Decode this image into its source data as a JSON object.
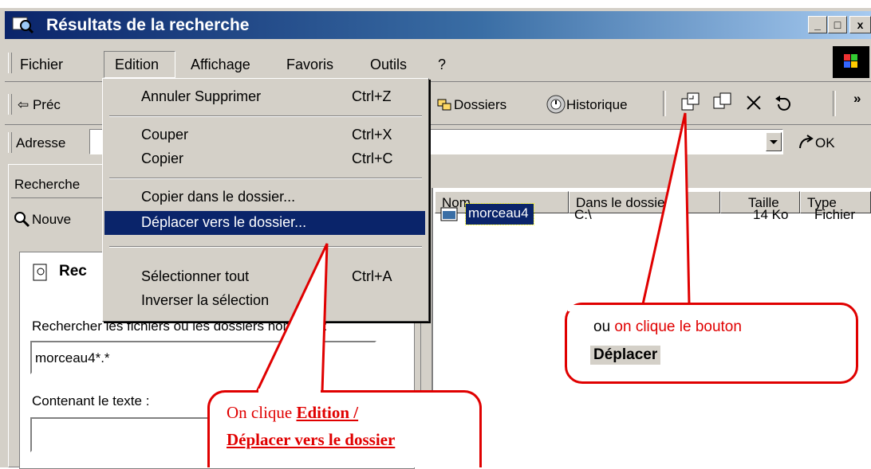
{
  "window": {
    "title": "Résultats de la recherche"
  },
  "caption_buttons": {
    "minimize": "_",
    "maximize": "□",
    "close": "x"
  },
  "menubar": [
    {
      "label": "Fichier"
    },
    {
      "label": "Edition"
    },
    {
      "label": "Affichage"
    },
    {
      "label": "Favoris"
    },
    {
      "label": "Outils"
    },
    {
      "label": "?"
    }
  ],
  "toolbar": {
    "back_label": "⇦ Préc",
    "folders_label": "Dossiers",
    "history_label": "Historique",
    "more_label": "»"
  },
  "address": {
    "label": "Adresse",
    "value": "",
    "go_label": "OK"
  },
  "left_panel": {
    "header": "Recherche",
    "new_label": "Nouve",
    "card_title": "Rec",
    "name_label": "Rechercher les fichiers ou les dossiers nommés :",
    "name_value": "morceau4*.*",
    "contains_label": "Contenant le texte :"
  },
  "list": {
    "columns": [
      "Nom",
      "Dans le dossier",
      "Taille",
      "Type"
    ],
    "rows": [
      {
        "name": "morceau4",
        "folder": "C:\\",
        "size": "14 Ko",
        "type": "Fichier"
      }
    ]
  },
  "edit_menu": {
    "items": [
      {
        "label": "Annuler Supprimer",
        "shortcut": "Ctrl+Z"
      },
      {
        "label": "Couper",
        "shortcut": "Ctrl+X"
      },
      {
        "label": "Copier",
        "shortcut": "Ctrl+C"
      },
      {
        "label": "Copier dans le dossier...",
        "shortcut": ""
      },
      {
        "label": "Déplacer vers le dossier...",
        "shortcut": ""
      },
      {
        "label": "Sélectionner tout",
        "shortcut": "Ctrl+A"
      },
      {
        "label": "Inverser la sélection",
        "shortcut": ""
      }
    ]
  },
  "callouts": {
    "right_prefix": "ou ",
    "right_red": "on clique le bouton",
    "right_bold": "Déplacer",
    "bottom_prefix": "On clique ",
    "bottom_bold_1": "Edition /",
    "bottom_bold_2": "Déplacer vers le dossier"
  },
  "colors": {
    "callout_red": "#e00000",
    "selection": "#0a246a",
    "title_dark": "#0a246a"
  }
}
